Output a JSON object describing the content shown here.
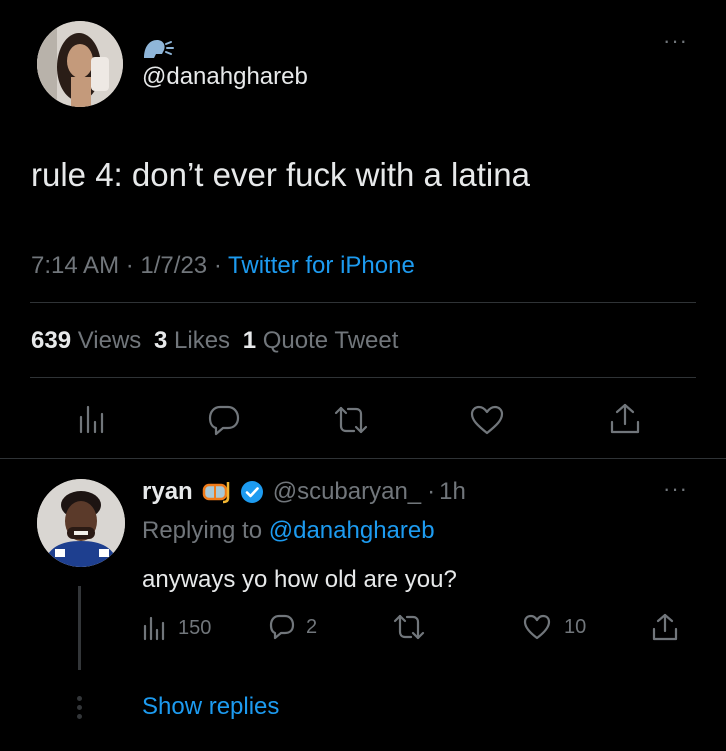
{
  "tweet": {
    "handle": "@danahghareb",
    "text": "rule 4: don’t ever fuck with a latina",
    "time": "7:14 AM",
    "date": "1/7/23",
    "source": "Twitter for iPhone",
    "stats": {
      "views_count": "639",
      "views_label": "Views",
      "likes_count": "3",
      "likes_label": "Likes",
      "quotes_count": "1",
      "quotes_label": "Quote Tweet"
    }
  },
  "reply": {
    "name": "ryan",
    "handle": "@scubaryan_",
    "age": "1h",
    "replying_to_prefix": "Replying to",
    "replying_to_handle": "@danahghareb",
    "text": "anyways yo how old are you?",
    "views": "150",
    "replies": "2",
    "likes": "10"
  },
  "show_replies_label": "Show replies",
  "separators": {
    "dot": "·"
  },
  "colors": {
    "background": "#000000",
    "text": "#e7e9ea",
    "muted": "#71767b",
    "accent": "#1d9bf0"
  }
}
